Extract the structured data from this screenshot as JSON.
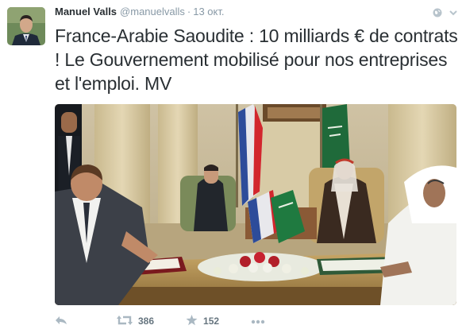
{
  "tweet": {
    "author_name": "Manuel Valls",
    "author_handle": "@manuelvalls",
    "separator": "·",
    "timestamp": "13 окт.",
    "text": "France-Arabie Saoudite : 10 milliards € de contrats ! Le Gouvernement mobilisé pour nos entreprises et l'emploi. MV",
    "retweet_count": "386",
    "favorite_count": "152"
  },
  "icons": {
    "header_left": "globe-icon",
    "header_right": "chevron-down-icon",
    "reply": "reply-arrow-icon",
    "retweet": "retweet-icon",
    "favorite": "star-icon",
    "more": "more-dots-icon"
  },
  "colors": {
    "text": "#292f33",
    "muted": "#8899a6",
    "action": "#aab8c2"
  }
}
